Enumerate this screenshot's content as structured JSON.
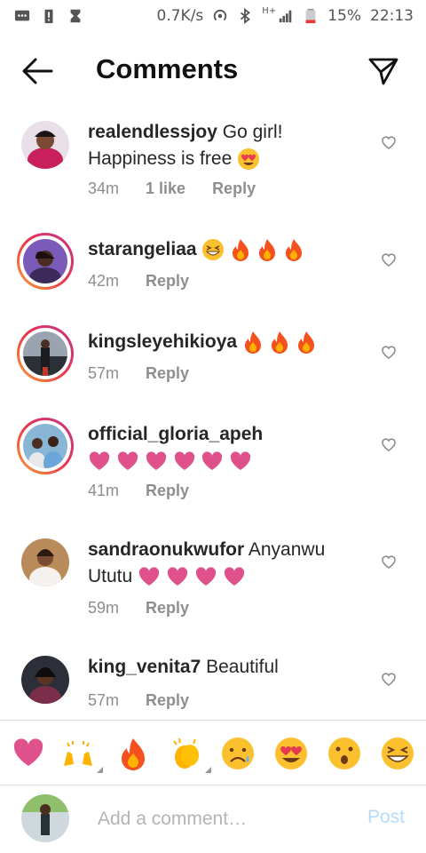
{
  "status_bar": {
    "speed": "0.7K/s",
    "network": "H+",
    "battery": "15%",
    "time": "22:13",
    "icons": [
      "message-icon",
      "battery-alert-icon",
      "hourglass-icon",
      "hotspot-icon",
      "bluetooth-icon",
      "signal-icon",
      "battery-icon"
    ]
  },
  "header": {
    "title": "Comments",
    "back_icon": "arrow-left-icon",
    "send_icon": "paper-plane-icon"
  },
  "comments": [
    {
      "username": "realendlessjoy",
      "text": "Go girl! Happiness is free",
      "emojis": [
        "heart-eyes"
      ],
      "time": "34m",
      "likes": "1 like",
      "reply": "Reply"
    },
    {
      "username": "starangeliaa",
      "text": "",
      "emojis": [
        "grinning-squint",
        "fire",
        "fire",
        "fire"
      ],
      "time": "42m",
      "reply": "Reply"
    },
    {
      "username": "kingsleyehikioya",
      "text": "",
      "emojis": [
        "fire",
        "fire",
        "fire"
      ],
      "time": "57m",
      "reply": "Reply"
    },
    {
      "username": "official_gloria_apeh",
      "text": "",
      "emojis": [
        "heart",
        "heart",
        "heart",
        "heart",
        "heart",
        "heart"
      ],
      "time": "41m",
      "reply": "Reply"
    },
    {
      "username": "sandraonukwufor",
      "text": "Anyanwu Ututu",
      "emojis": [
        "heart",
        "heart",
        "heart",
        "heart"
      ],
      "time": "59m",
      "reply": "Reply"
    },
    {
      "username": "king_venita7",
      "text": "Beautiful",
      "emojis": [],
      "time": "57m",
      "reply": "Reply"
    }
  ],
  "emoji_bar": [
    "heart",
    "raised-hands",
    "fire",
    "clapping-hands",
    "sad-face",
    "heart-eyes",
    "surprised-face",
    "laughing-face"
  ],
  "composer": {
    "placeholder": "Add a comment…",
    "post_label": "Post"
  },
  "colors": {
    "accent_blue_disabled": "#b3dbfa",
    "heart_pink": "#e0508a",
    "fire_orange": "#f4511e",
    "meta_gray": "#8e8e8e"
  }
}
